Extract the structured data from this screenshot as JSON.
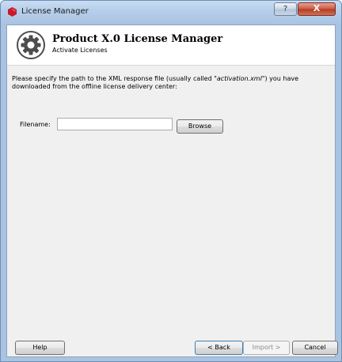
{
  "window": {
    "title": "License Manager",
    "help_caption": "?",
    "close_caption": "X"
  },
  "header": {
    "title": "Product X.0 License Manager",
    "subtitle": "Activate Licenses"
  },
  "instructions": {
    "text_before": "Please specify the path to the XML response file (usually called \"",
    "filename_example": "activation.xml",
    "text_after": "\") you have downloaded from the offline license delivery center:"
  },
  "filename": {
    "label": "Filename:",
    "value": "",
    "placeholder": ""
  },
  "buttons": {
    "browse": "Browse",
    "help": "Help",
    "back": "< Back",
    "import": "Import >",
    "cancel": "Cancel"
  },
  "colors": {
    "app_icon": "#c8192b",
    "gear": "#4d4d4d"
  }
}
